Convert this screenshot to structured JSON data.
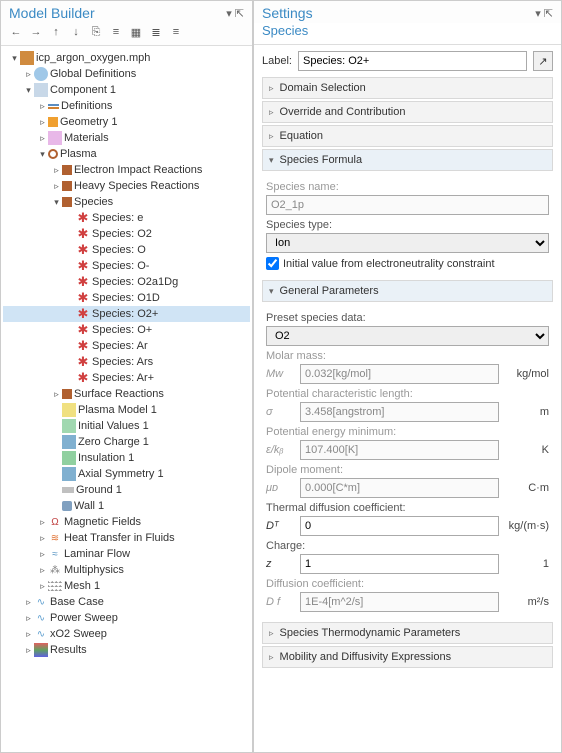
{
  "left": {
    "title": "Model Builder",
    "toolbar": [
      "←",
      "→",
      "↑",
      "↓",
      "⎘",
      "≡",
      "▦",
      "≣",
      "≡"
    ],
    "tree": [
      {
        "d": 0,
        "tw": "▾",
        "ic": "i-root",
        "t": "icp_argon_oxygen.mph"
      },
      {
        "d": 1,
        "tw": "▹",
        "ic": "i-globe",
        "t": "Global Definitions"
      },
      {
        "d": 1,
        "tw": "▾",
        "ic": "i-comp",
        "t": "Component 1"
      },
      {
        "d": 2,
        "tw": "▹",
        "ic": "i-def",
        "t": "Definitions"
      },
      {
        "d": 2,
        "tw": "▹",
        "ic": "i-geom",
        "t": "Geometry 1"
      },
      {
        "d": 2,
        "tw": "▹",
        "ic": "i-mat",
        "t": "Materials"
      },
      {
        "d": 2,
        "tw": "▾",
        "ic": "i-plasma",
        "t": "Plasma"
      },
      {
        "d": 3,
        "tw": "▹",
        "ic": "i-hex",
        "t": "Electron Impact Reactions"
      },
      {
        "d": 3,
        "tw": "▹",
        "ic": "i-hex",
        "t": "Heavy Species Reactions"
      },
      {
        "d": 3,
        "tw": "▾",
        "ic": "i-hex",
        "t": "Species"
      },
      {
        "d": 4,
        "tw": "",
        "ic": "i-sp",
        "t": "Species: e"
      },
      {
        "d": 4,
        "tw": "",
        "ic": "i-sp",
        "t": "Species: O2"
      },
      {
        "d": 4,
        "tw": "",
        "ic": "i-sp",
        "t": "Species: O"
      },
      {
        "d": 4,
        "tw": "",
        "ic": "i-sp",
        "t": "Species: O-"
      },
      {
        "d": 4,
        "tw": "",
        "ic": "i-sp",
        "t": "Species: O2a1Dg"
      },
      {
        "d": 4,
        "tw": "",
        "ic": "i-sp",
        "t": "Species: O1D"
      },
      {
        "d": 4,
        "tw": "",
        "ic": "i-sp",
        "t": "Species: O2+",
        "sel": true
      },
      {
        "d": 4,
        "tw": "",
        "ic": "i-sp",
        "t": "Species: O+"
      },
      {
        "d": 4,
        "tw": "",
        "ic": "i-sp",
        "t": "Species: Ar"
      },
      {
        "d": 4,
        "tw": "",
        "ic": "i-sp",
        "t": "Species: Ars"
      },
      {
        "d": 4,
        "tw": "",
        "ic": "i-sp",
        "t": "Species: Ar+"
      },
      {
        "d": 3,
        "tw": "▹",
        "ic": "i-hex",
        "t": "Surface Reactions"
      },
      {
        "d": 3,
        "tw": "",
        "ic": "i-pm",
        "t": "Plasma Model 1"
      },
      {
        "d": 3,
        "tw": "",
        "ic": "i-iv",
        "t": "Initial Values 1"
      },
      {
        "d": 3,
        "tw": "",
        "ic": "i-zc",
        "t": "Zero Charge 1"
      },
      {
        "d": 3,
        "tw": "",
        "ic": "i-ins",
        "t": "Insulation 1"
      },
      {
        "d": 3,
        "tw": "",
        "ic": "i-ax",
        "t": "Axial Symmetry 1"
      },
      {
        "d": 3,
        "tw": "",
        "ic": "i-gnd",
        "t": "Ground 1"
      },
      {
        "d": 3,
        "tw": "",
        "ic": "i-wall",
        "t": "Wall 1"
      },
      {
        "d": 2,
        "tw": "▹",
        "ic": "i-mag",
        "t": "Magnetic Fields"
      },
      {
        "d": 2,
        "tw": "▹",
        "ic": "i-heat",
        "t": "Heat Transfer in Fluids"
      },
      {
        "d": 2,
        "tw": "▹",
        "ic": "i-flow",
        "t": "Laminar Flow"
      },
      {
        "d": 2,
        "tw": "▹",
        "ic": "i-multi",
        "t": "Multiphysics"
      },
      {
        "d": 2,
        "tw": "▹",
        "ic": "i-mesh",
        "t": "Mesh 1"
      },
      {
        "d": 1,
        "tw": "▹",
        "ic": "i-sweep",
        "t": "Base Case"
      },
      {
        "d": 1,
        "tw": "▹",
        "ic": "i-sweep",
        "t": "Power Sweep"
      },
      {
        "d": 1,
        "tw": "▹",
        "ic": "i-sweep",
        "t": "xO2 Sweep"
      },
      {
        "d": 1,
        "tw": "▹",
        "ic": "i-res",
        "t": "Results"
      }
    ]
  },
  "right": {
    "title": "Settings",
    "subtitle": "Species",
    "label_caption": "Label:",
    "label_value": "Species: O2+",
    "sections": {
      "domain": "Domain Selection",
      "override": "Override and Contribution",
      "equation": "Equation",
      "formula": "Species Formula",
      "general": "General Parameters",
      "thermo": "Species Thermodynamic Parameters",
      "mobility": "Mobility and Diffusivity Expressions"
    },
    "formula": {
      "name_l": "Species name:",
      "name_v": "O2_1p",
      "type_l": "Species type:",
      "type_v": "Ion",
      "chk": "Initial value from electroneutrality constraint"
    },
    "gen": {
      "preset_l": "Preset species data:",
      "preset_v": "O2",
      "mw_l": "Molar mass:",
      "mw_s": "Mᴡ",
      "mw_v": "0.032[kg/mol]",
      "mw_u": "kg/mol",
      "pcl_l": "Potential characteristic length:",
      "pcl_s": "σ",
      "pcl_v": "3.458[angstrom]",
      "pcl_u": "m",
      "pem_l": "Potential energy minimum:",
      "pem_s": "ε/kᵦ",
      "pem_v": "107.400[K]",
      "pem_u": "K",
      "dip_l": "Dipole moment:",
      "dip_s": "μᴅ",
      "dip_v": "0.000[C*m]",
      "dip_u": "C·m",
      "tdc_l": "Thermal diffusion coefficient:",
      "tdc_s": "Dᵀ",
      "tdc_v": "0",
      "tdc_u": "kg/(m·s)",
      "chg_l": "Charge:",
      "chg_s": "z",
      "chg_v": "1",
      "chg_u": "1",
      "dif_l": "Diffusion coefficient:",
      "dif_s": "D f",
      "dif_v": "1E-4[m^2/s]",
      "dif_u": "m²/s"
    }
  }
}
